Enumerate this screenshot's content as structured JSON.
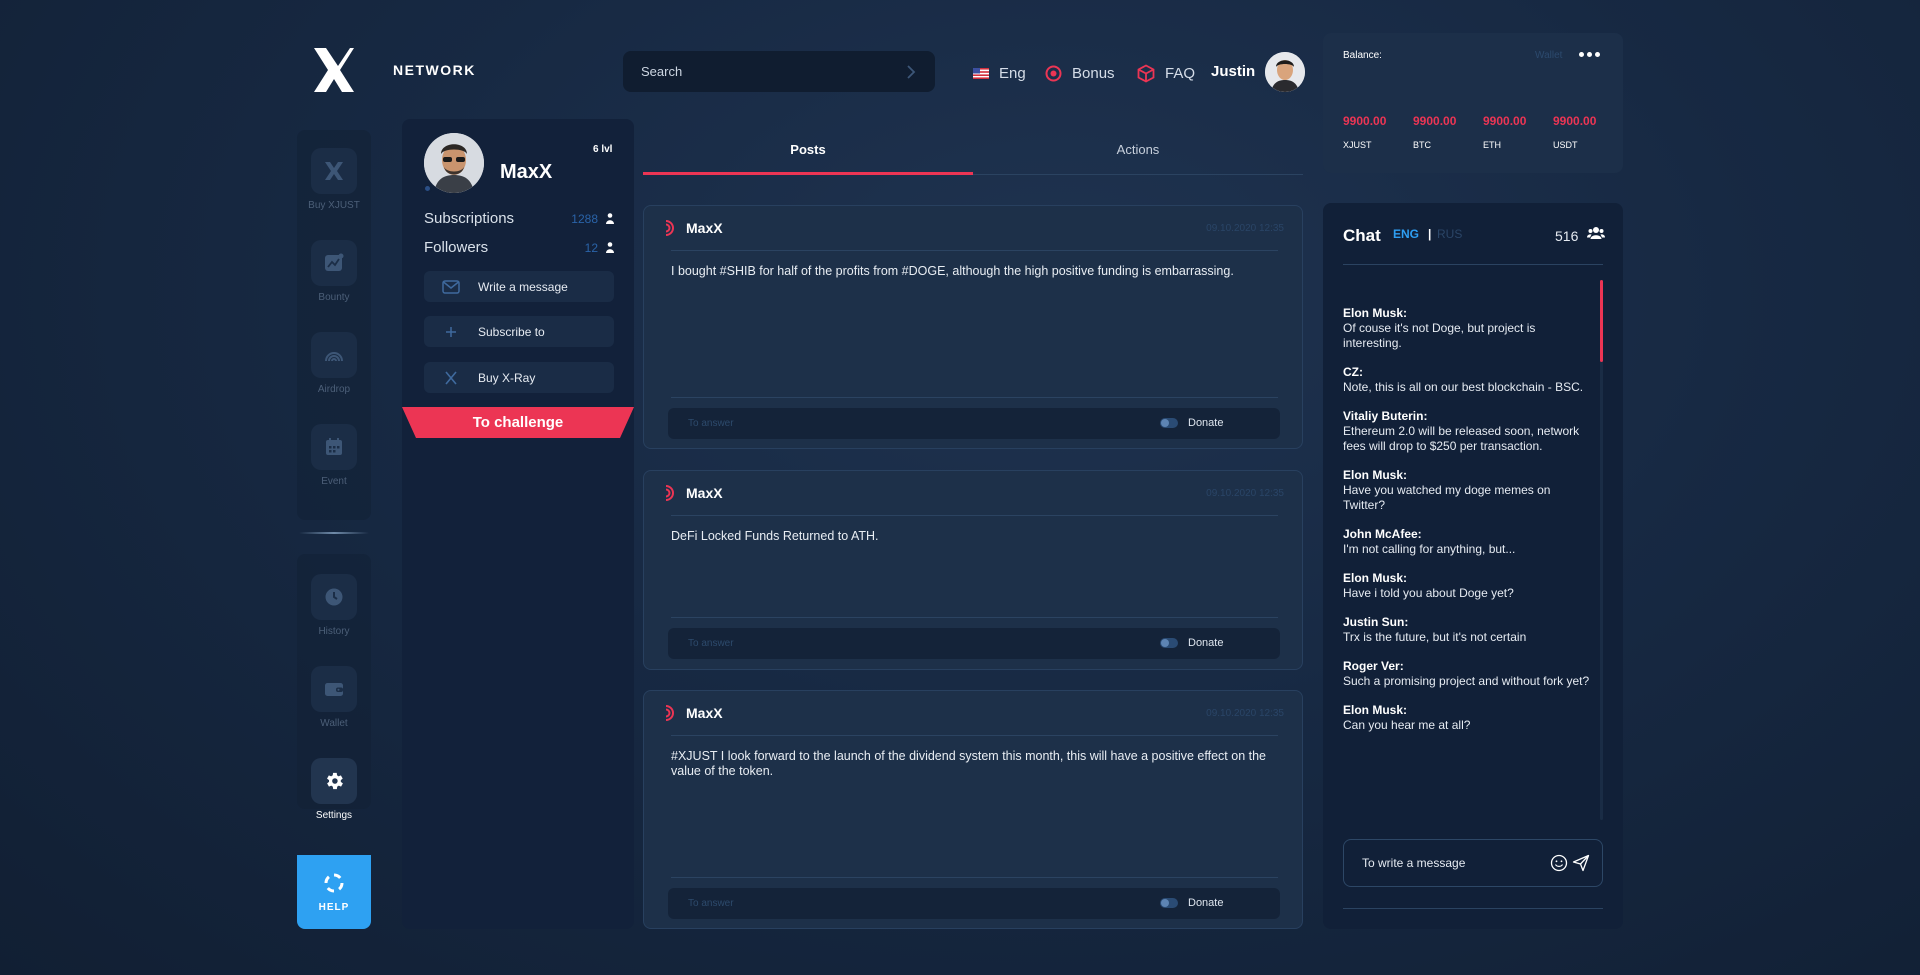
{
  "brand": {
    "name": "NETWORK"
  },
  "search": {
    "placeholder": "Search"
  },
  "topnav": {
    "language": "Eng",
    "bonus": "Bonus",
    "faq": "FAQ",
    "user_name": "Justin"
  },
  "sidebar": {
    "items": [
      {
        "label": "Buy XJUST",
        "icon": "x-logo-icon"
      },
      {
        "label": "Bounty",
        "icon": "chart-icon"
      },
      {
        "label": "Airdrop",
        "icon": "airdrop-icon"
      },
      {
        "label": "Event",
        "icon": "calendar-icon"
      }
    ],
    "bottom_items": [
      {
        "label": "History",
        "icon": "clock-icon"
      },
      {
        "label": "Wallet",
        "icon": "wallet-icon"
      },
      {
        "label": "Settings",
        "icon": "gear-icon",
        "active": true
      }
    ],
    "help_label": "HELP"
  },
  "balance": {
    "title": "Balance:",
    "wallet_link": "Wallet",
    "items": [
      {
        "value": "9900.00",
        "currency": "XJUST"
      },
      {
        "value": "9900.00",
        "currency": "BTC"
      },
      {
        "value": "9900.00",
        "currency": "ETH"
      },
      {
        "value": "9900.00",
        "currency": "USDT"
      }
    ],
    "accent_color": "#ec3554"
  },
  "profile": {
    "name": "MaxX",
    "level": "6 lvl",
    "subscriptions_label": "Subscriptions",
    "subscriptions_count": "1288",
    "followers_label": "Followers",
    "followers_count": "12",
    "write_message": "Write a message",
    "subscribe": "Subscribe to",
    "buy": "Buy X-Ray",
    "challenge": "To challenge"
  },
  "tabs": [
    {
      "label": "Posts",
      "active": true
    },
    {
      "label": "Actions",
      "active": false
    }
  ],
  "posts": [
    {
      "author": "MaxX",
      "date": "09.10.2020  12:35",
      "text": "I bought #SHIB for half of the profits from #DOGE, although the high positive funding is embarrassing.",
      "answer_placeholder": "To answer",
      "donate": "Donate"
    },
    {
      "author": "MaxX",
      "date": "09.10.2020  12:35",
      "text": "DeFi Locked Funds Returned to ATH.",
      "answer_placeholder": "To answer",
      "donate": "Donate"
    },
    {
      "author": "MaxX",
      "date": "09.10.2020  12:35",
      "text": "#XJUST I look forward to the launch of the dividend system this month, this will have a positive effect on the value of the token.",
      "answer_placeholder": "To answer",
      "donate": "Donate"
    }
  ],
  "chat": {
    "title": "Chat",
    "lang_active": "ENG",
    "lang_separator": "|",
    "lang_inactive": "RUS",
    "online_count": "516",
    "messages": [
      {
        "author": "Elon Musk:",
        "text": "Of couse it's not Doge, but project is interesting."
      },
      {
        "author": "CZ:",
        "text": "Note, this is all on our best blockchain - BSC."
      },
      {
        "author": "Vitaliy Buterin:",
        "text": "Ethereum 2.0 will be released soon, network fees will drop to $250 per transaction."
      },
      {
        "author": "Elon Musk:",
        "text": "Have you watched my doge memes on Twitter?"
      },
      {
        "author": "John McAfee:",
        "text": "I'm not calling for anything, but..."
      },
      {
        "author": "Elon Musk:",
        "text": "Have i told you about Doge yet?"
      },
      {
        "author": "Justin Sun:",
        "text": "Trx is the future, but it's not certain"
      },
      {
        "author": "Roger Ver:",
        "text": "Such a promising project and without fork yet?"
      },
      {
        "author": "Elon Musk:",
        "text": "Can you hear me at all?"
      }
    ],
    "input_placeholder": "To write a message"
  },
  "colors": {
    "accent": "#ec3554",
    "blue": "#2ea1f2",
    "panel": "#12213a",
    "background": "#172943"
  }
}
